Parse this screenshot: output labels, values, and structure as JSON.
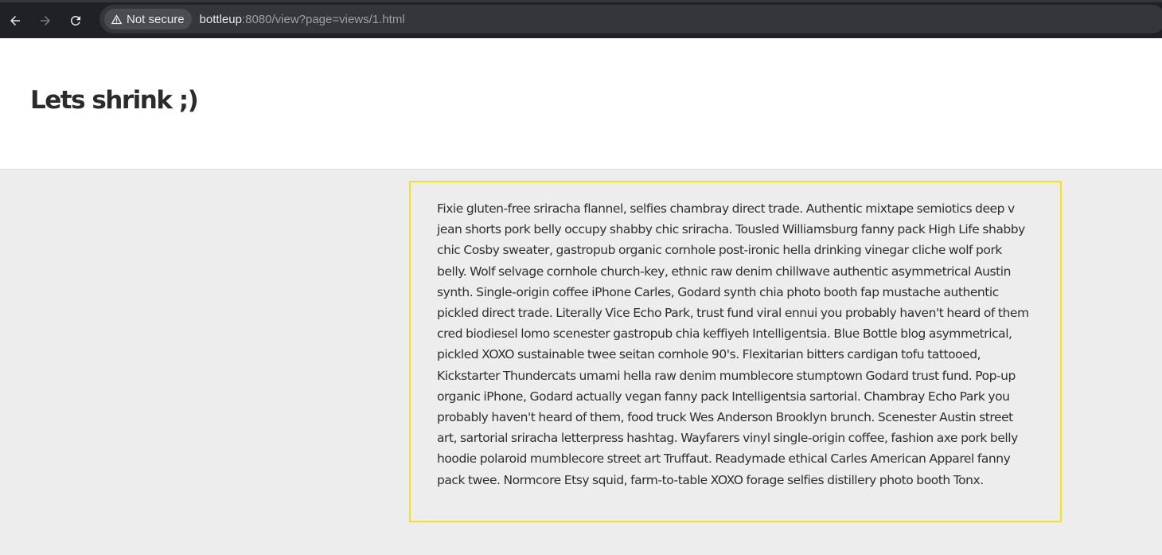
{
  "browser": {
    "security_label": "Not secure",
    "url_host": "bottleup",
    "url_rest": ":8080/view?page=views/1.html"
  },
  "page": {
    "title": "Lets shrink ;)",
    "paragraph": "Fixie gluten-free sriracha flannel, selfies chambray direct trade. Authentic mixtape semiotics deep v jean shorts pork belly occupy shabby chic sriracha. Tousled Williamsburg fanny pack High Life shabby chic Cosby sweater, gastropub organic cornhole post-ironic hella drinking vinegar cliche wolf pork belly. Wolf selvage cornhole church-key, ethnic raw denim chillwave authentic asymmetrical Austin synth. Single-origin coffee iPhone Carles, Godard synth chia photo booth fap mustache authentic pickled direct trade. Literally Vice Echo Park, trust fund viral ennui you probably haven't heard of them cred biodiesel lomo scenester gastropub chia keffiyeh Intelligentsia. Blue Bottle blog asymmetrical, pickled XOXO sustainable twee seitan cornhole 90's. Flexitarian bitters cardigan tofu tattooed, Kickstarter Thundercats umami hella raw denim mumblecore stumptown Godard trust fund. Pop-up organic iPhone, Godard actually vegan fanny pack Intelligentsia sartorial. Chambray Echo Park you probably haven't heard of them, food truck Wes Anderson Brooklyn brunch. Scenester Austin street art, sartorial sriracha letterpress hashtag. Wayfarers vinyl single-origin coffee, fashion axe pork belly hoodie polaroid mumblecore street art Truffaut. Readymade ethical Carles American Apparel fanny pack twee. Normcore Etsy squid, farm-to-table XOXO forage selfies distillery photo booth Tonx."
  },
  "colors": {
    "toolbar_bg": "#202124",
    "omnibox_bg": "#35363a",
    "page_bg": "#ededed",
    "header_bg": "#ffffff",
    "box_border": "#f5e31a"
  },
  "icons": [
    "back-arrow-icon",
    "forward-arrow-icon",
    "reload-icon",
    "warning-triangle-icon"
  ]
}
